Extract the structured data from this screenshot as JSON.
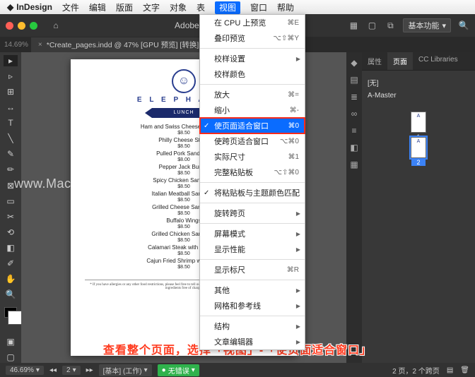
{
  "mac_menu": {
    "app": "InDesign",
    "items": [
      "文件",
      "编辑",
      "版面",
      "文字",
      "对象",
      "表",
      "视图",
      "窗口",
      "帮助"
    ],
    "active_index": 6
  },
  "app_bar": {
    "title": "Adobe InDesign",
    "workspace": "基本功能"
  },
  "doc_tab": {
    "label": "*Create_pages.indd @ 47% [GPU 预览] [转换]"
  },
  "dropdown": {
    "groups": [
      [
        {
          "label": "在 CPU 上预览",
          "shortcut": "⌘E"
        },
        {
          "label": "叠印预览",
          "shortcut": "⌥⇧⌘Y"
        }
      ],
      [
        {
          "label": "校样设置",
          "submenu": true
        },
        {
          "label": "校样颜色"
        }
      ],
      [
        {
          "label": "放大",
          "shortcut": "⌘="
        },
        {
          "label": "缩小",
          "shortcut": "⌘-"
        },
        {
          "label": "使页面适合窗口",
          "shortcut": "⌘0",
          "selected": true,
          "checked": true
        },
        {
          "label": "使跨页适合窗口",
          "shortcut": "⌥⌘0"
        },
        {
          "label": "实际尺寸",
          "shortcut": "⌘1"
        },
        {
          "label": "完整粘贴板",
          "shortcut": "⌥⇧⌘0"
        }
      ],
      [
        {
          "label": "将粘贴板与主题颜色匹配",
          "checked": true
        }
      ],
      [
        {
          "label": "旋转跨页",
          "submenu": true
        }
      ],
      [
        {
          "label": "屏幕模式",
          "submenu": true
        },
        {
          "label": "显示性能",
          "submenu": true
        }
      ],
      [
        {
          "label": "显示标尺",
          "shortcut": "⌘R"
        }
      ],
      [
        {
          "label": "其他",
          "submenu": true
        },
        {
          "label": "网格和参考线",
          "submenu": true
        }
      ],
      [
        {
          "label": "结构",
          "submenu": true
        },
        {
          "label": "文章编辑器",
          "submenu": true
        }
      ]
    ]
  },
  "page_doc": {
    "brand": "E L E P H A N T",
    "section": "LUNCH",
    "items": [
      {
        "name": "Ham and Swiss Cheese Sandwich",
        "price": "$8.50"
      },
      {
        "name": "Philly Cheese Steak",
        "price": "$8.50"
      },
      {
        "name": "Pulled Pork Sandwich",
        "price": "$8.00"
      },
      {
        "name": "Pepper Jack Burger",
        "price": "$8.50"
      },
      {
        "name": "Spicy Chicken Sandwich",
        "price": "$8.50"
      },
      {
        "name": "Italian Meatball Sandwich",
        "price": "$8.50"
      },
      {
        "name": "Grilled Cheese Sandwich",
        "price": "$8.50"
      },
      {
        "name": "Buffalo Wings",
        "price": "$8.50"
      },
      {
        "name": "Grilled Chicken Sandwich",
        "price": "$8.50"
      },
      {
        "name": "Calamari Steak with Veggies",
        "price": "$8.50"
      },
      {
        "name": "Cajun Fried Shrimp with Fries",
        "price": "$8.50"
      }
    ],
    "disclaimer": "* If you have allergies or any other food restrictions, please feel free to tell our servers. We will be more than happy to substitute any ingredients free of charge."
  },
  "right_panel": {
    "tabs": [
      "属性",
      "页面",
      "CC Libraries"
    ],
    "active": 1,
    "list": [
      "[无]",
      "A-Master"
    ],
    "thumbs": [
      {
        "label": "1"
      },
      {
        "label": "2",
        "selected": true
      }
    ]
  },
  "status": {
    "zoom": "46.69%",
    "zoom_tab": "14.69%",
    "page": "2",
    "mode": "[基本] (工作)",
    "errors": "无错误",
    "spread": "2 页，2 个跨页"
  },
  "watermark": "www.MacZ.com",
  "caption": "查看整个页面，选择「视图」-「使页面适合窗口」"
}
